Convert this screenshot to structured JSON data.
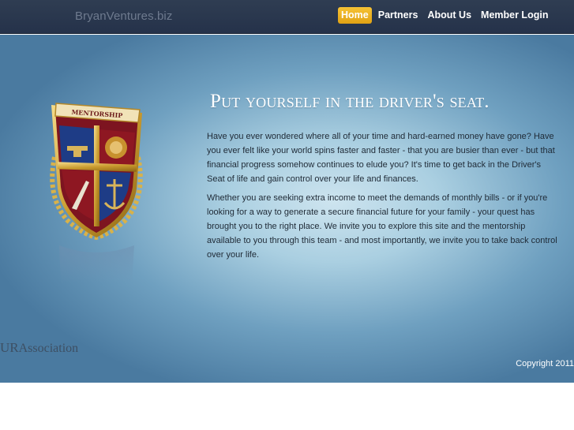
{
  "header": {
    "site_name": "BryanVentures.biz",
    "nav": [
      {
        "label": "Home",
        "active": true
      },
      {
        "label": "Partners",
        "active": false
      },
      {
        "label": "About Us",
        "active": false
      },
      {
        "label": "Member Login",
        "active": false
      }
    ],
    "active_color": "#f0b429",
    "bar_color": "#2a3850"
  },
  "hero": {
    "crest_banner": "MENTORSHIP",
    "headline": "Put yourself in the driver's seat.",
    "paragraphs": [
      "Have you ever wondered where all of your time and hard-earned money have gone? Have you ever felt like your world spins faster and faster - that you are busier than ever - but that financial progress somehow continues to elude you? It's time to get back in the Driver's Seat of life and gain control over your life and finances.",
      "Whether you are seeking extra income to meet the demands of monthly bills - or if you're looking for a way to generate a secure financial future for your family - your quest has brought you to the right place. We invite you to explore this site and the mentorship available to you through this team - and most importantly, we invite you to take back control over your life."
    ]
  },
  "footer": {
    "association_prefix": "UR",
    "association_suffix": "Association",
    "copyright": "Copyright 2011"
  }
}
